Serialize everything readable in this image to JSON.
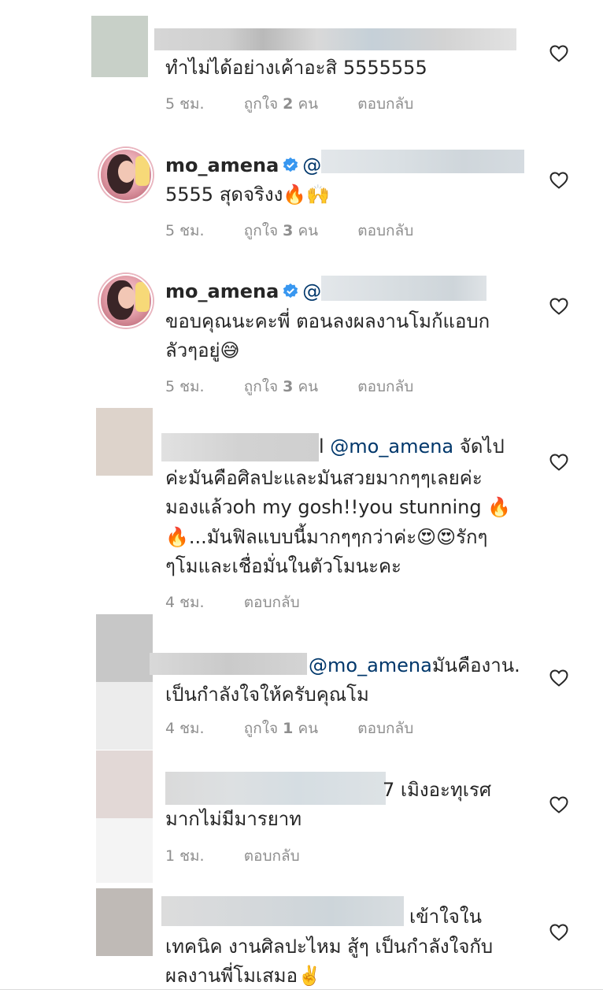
{
  "comments": [
    {
      "text": "ทำไม่ได้อย่างเค้าอะสิ 5555555",
      "time": "5 ชม.",
      "likes_label": "ถูกใจ",
      "likes_count": "2",
      "likes_unit": "คน",
      "reply": "ตอบกลับ"
    },
    {
      "username": "mo_amena",
      "mention_prefix": "@",
      "text": "5555 สุดจริงง🔥🙌",
      "time": "5 ชม.",
      "likes_label": "ถูกใจ",
      "likes_count": "3",
      "likes_unit": "คน",
      "reply": "ตอบกลับ"
    },
    {
      "username": "mo_amena",
      "mention_prefix": "@",
      "line1": "ขอบคุณนะคะพี่ ตอนลงผลงานโมก้แอบก",
      "line2": "ลัวๆอยู่😅",
      "time": "5 ชม.",
      "likes_label": "ถูกใจ",
      "likes_count": "3",
      "likes_unit": "คน",
      "reply": "ตอบกลับ"
    },
    {
      "mention": "@mo_amena",
      "line1_tail": "จัดไป",
      "line2": "ค่ะมันคือศิลปะและมันสวยมากๆๆเลยค่ะ",
      "line3": "มองแล้วoh my gosh!!you stunning 🔥",
      "line4": "🔥...มันฟิลแบบนี้มากๆๆกว่าค่ะ😍😍รักๆ",
      "line5": "ๆโมและเชื่อมั่นในตัวโมนะคะ",
      "time": "4 ชม.",
      "reply": "ตอบกลับ"
    },
    {
      "mention": "@mo_amena",
      "line1_tail": "มันคืองาน.",
      "line2": "เป็นกำลังใจให้ครับคุณโม",
      "time": "4 ชม.",
      "likes_label": "ถูกใจ",
      "likes_count": "1",
      "likes_unit": "คน",
      "reply": "ตอบกลับ"
    },
    {
      "line1_tail": "7 เมิงอะทุเรศ",
      "line2": "มากไม่มีมารยาท",
      "time": "1 ชม.",
      "reply": "ตอบกลับ"
    },
    {
      "line1_tail": "เข้าใจใน",
      "line2": "เทคนิค งานศิลปะไหม สู้ๆ เป็นกำลังใจกับ",
      "line3": "ผลงานพี่โมเสมอ✌️"
    }
  ],
  "colors": {
    "text": "#262626",
    "mention": "#00376b",
    "meta": "#8e8e8e",
    "verified": "#3897f0"
  }
}
